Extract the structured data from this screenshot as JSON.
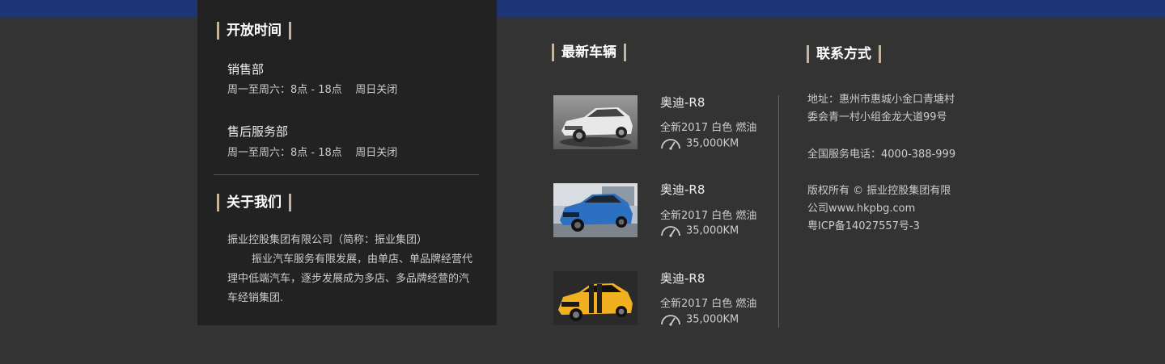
{
  "opening_hours": {
    "title": "开放时间",
    "sales_dept": "销售部",
    "sales_hours": "周一至周六：8点 - 18点    周日关闭",
    "service_dept": "售后服务部",
    "service_hours": "周一至周六：8点 - 18点    周日关闭"
  },
  "about": {
    "title": "关于我们",
    "line1": "振业控股集团有限公司（简称：振业集团）",
    "paragraph": "振业汽车服务有限发展，由单店、单品牌经营代理中低端汽车，逐步发展成为多店、多品牌经营的汽车经销集团."
  },
  "latest_cars": {
    "title": "最新车辆",
    "cars": [
      {
        "name": "奥迪-R8",
        "desc": "全新2017 白色 燃油",
        "mileage": "35,000KM",
        "color": "silver"
      },
      {
        "name": "奥迪-R8",
        "desc": "全新2017 白色 燃油",
        "mileage": "35,000KM",
        "color": "blue"
      },
      {
        "name": "奥迪-R8",
        "desc": "全新2017 白色 燃油",
        "mileage": "35,000KM",
        "color": "yellow"
      }
    ]
  },
  "contact": {
    "title": "联系方式",
    "address_line1": "地址：惠州市惠城小金口青塘村",
    "address_line2": "委会青一村小组金龙大道99号",
    "phone": "全国服务电话：4000-388-999",
    "copyright_line1": "版权所有 © 振业控股集团有限",
    "copyright_line2": "公司www.hkpbg.com",
    "icp": "粤ICP备14027557号-3"
  },
  "colors": {
    "top_bar": "#1e3575",
    "background": "#333333",
    "panel": "#222222",
    "accent": "#c2b59b"
  }
}
